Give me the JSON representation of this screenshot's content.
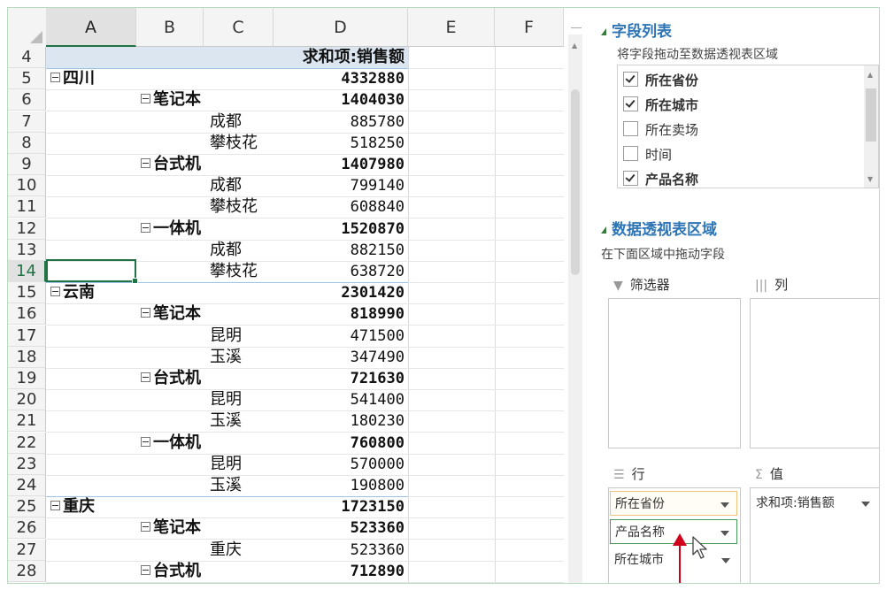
{
  "sheet": {
    "columns": [
      "A",
      "B",
      "C",
      "D",
      "E",
      "F"
    ],
    "rows": [
      {
        "n": "4",
        "level": "head",
        "label": "",
        "value": "求和项:销售额"
      },
      {
        "n": "5",
        "level": 0,
        "label": "四川",
        "value": "4332880"
      },
      {
        "n": "6",
        "level": 1,
        "label": "笔记本",
        "value": "1404030"
      },
      {
        "n": "7",
        "level": 2,
        "label": "成都",
        "value": "885780"
      },
      {
        "n": "8",
        "level": 2,
        "label": "攀枝花",
        "value": "518250"
      },
      {
        "n": "9",
        "level": 1,
        "label": "台式机",
        "value": "1407980"
      },
      {
        "n": "10",
        "level": 2,
        "label": "成都",
        "value": "799140"
      },
      {
        "n": "11",
        "level": 2,
        "label": "攀枝花",
        "value": "608840"
      },
      {
        "n": "12",
        "level": 1,
        "label": "一体机",
        "value": "1520870"
      },
      {
        "n": "13",
        "level": 2,
        "label": "成都",
        "value": "882150"
      },
      {
        "n": "14",
        "level": 2,
        "label": "攀枝花",
        "value": "638720"
      },
      {
        "n": "15",
        "level": 0,
        "label": "云南",
        "value": "2301420"
      },
      {
        "n": "16",
        "level": 1,
        "label": "笔记本",
        "value": "818990"
      },
      {
        "n": "17",
        "level": 2,
        "label": "昆明",
        "value": "471500"
      },
      {
        "n": "18",
        "level": 2,
        "label": "玉溪",
        "value": "347490"
      },
      {
        "n": "19",
        "level": 1,
        "label": "台式机",
        "value": "721630"
      },
      {
        "n": "20",
        "level": 2,
        "label": "昆明",
        "value": "541400"
      },
      {
        "n": "21",
        "level": 2,
        "label": "玉溪",
        "value": "180230"
      },
      {
        "n": "22",
        "level": 1,
        "label": "一体机",
        "value": "760800"
      },
      {
        "n": "23",
        "level": 2,
        "label": "昆明",
        "value": "570000"
      },
      {
        "n": "24",
        "level": 2,
        "label": "玉溪",
        "value": "190800"
      },
      {
        "n": "25",
        "level": 0,
        "label": "重庆",
        "value": "1723150"
      },
      {
        "n": "26",
        "level": 1,
        "label": "笔记本",
        "value": "523360"
      },
      {
        "n": "27",
        "level": 2,
        "label": "重庆",
        "value": "523360"
      },
      {
        "n": "28",
        "level": 1,
        "label": "台式机",
        "value": "712890"
      }
    ],
    "active_row": "14",
    "active_col": "A"
  },
  "pane": {
    "field_list_title": "字段列表",
    "field_list_hint": "将字段拖动至数据透视表区域",
    "fields": [
      {
        "label": "所在省份",
        "checked": true
      },
      {
        "label": "所在城市",
        "checked": true
      },
      {
        "label": "所在卖场",
        "checked": false
      },
      {
        "label": "时间",
        "checked": false
      },
      {
        "label": "产品名称",
        "checked": true
      }
    ],
    "areas_title": "数据透视表区域",
    "areas_hint": "在下面区域中拖动字段",
    "filter_label": "筛选器",
    "columns_label": "列",
    "rows_label": "行",
    "values_label": "值",
    "row_fields": [
      "所在省份",
      "产品名称",
      "所在城市"
    ],
    "value_fields": [
      "求和项:销售额"
    ]
  },
  "colors": {
    "accent": "#217346",
    "pivot_header": "#dce6f1",
    "annotation_arrow": "#d0021b",
    "title": "#2e75b6"
  }
}
